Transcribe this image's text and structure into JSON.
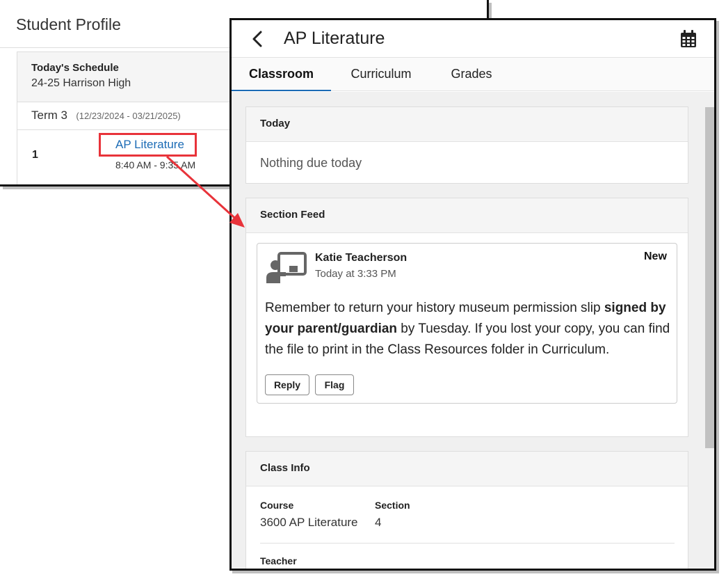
{
  "student_profile": {
    "title": "Student Profile",
    "schedule": {
      "heading": "Today's Schedule",
      "school": "24-25 Harrison High",
      "term": "Term 3",
      "term_dates": "(12/23/2024 - 03/21/2025)",
      "period": "1",
      "course_link": "AP Literature",
      "course_time": "8:40 AM - 9:35 AM"
    }
  },
  "annotation": {
    "highlight_color": "#e8333a"
  },
  "course_page": {
    "title": "AP Literature",
    "back_icon": "chevron-left-icon",
    "calendar_icon": "calendar-icon",
    "tabs": [
      {
        "label": "Classroom",
        "active": true
      },
      {
        "label": "Curriculum",
        "active": false
      },
      {
        "label": "Grades",
        "active": false
      }
    ],
    "today": {
      "heading": "Today",
      "empty_text": "Nothing due today"
    },
    "section_feed": {
      "heading": "Section Feed",
      "post": {
        "author": "Katie Teacherson",
        "time": "Today at 3:33 PM",
        "badge": "New",
        "body_part1": "Remember to return your history museum permission slip ",
        "body_bold": "signed by your parent/guardian",
        "body_part2": " by Tuesday. If you lost your copy, you can find the file to print in the Class Resources folder in Curriculum.",
        "reply_label": "Reply",
        "flag_label": "Flag"
      }
    },
    "class_info": {
      "heading": "Class Info",
      "course_label": "Course",
      "course_value": "3600 AP Literature",
      "section_label": "Section",
      "section_value": "4",
      "teacher_label": "Teacher"
    }
  },
  "colors": {
    "link_blue": "#1b6bb5",
    "tab_underline": "#1b6bb5"
  }
}
